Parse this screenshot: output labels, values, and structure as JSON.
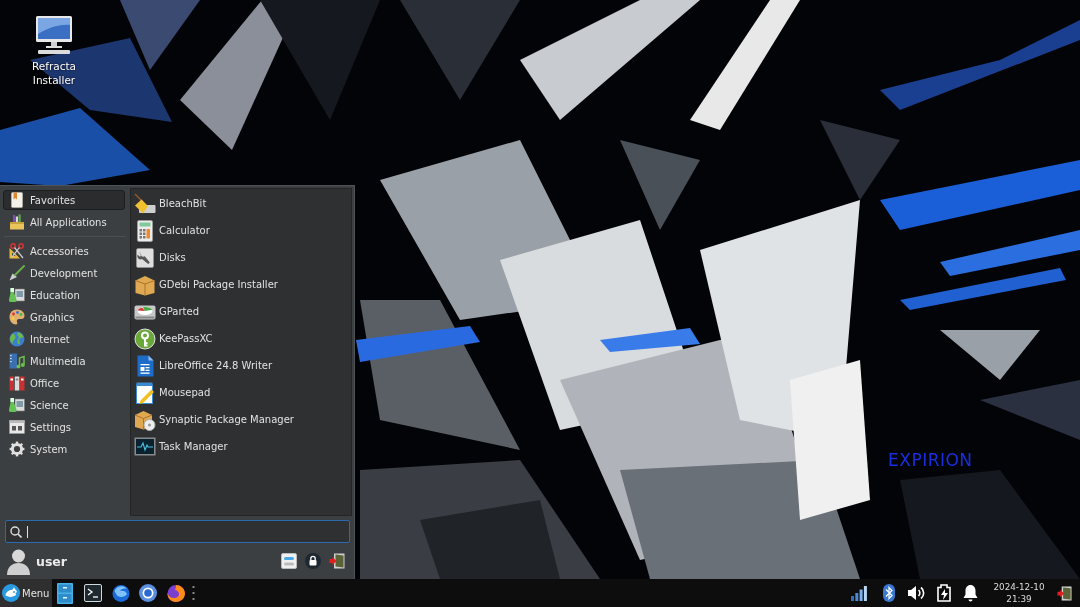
{
  "desktop": {
    "shortcuts": [
      {
        "label": "Refracta Installer"
      }
    ],
    "wallpaper_text": "EXPIRION"
  },
  "menu": {
    "views": [
      {
        "label": "Favorites",
        "selected": true
      },
      {
        "label": "All Applications",
        "selected": false
      }
    ],
    "categories": [
      {
        "label": "Accessories",
        "selected": false
      },
      {
        "label": "Development",
        "selected": false
      },
      {
        "label": "Education",
        "selected": false
      },
      {
        "label": "Graphics",
        "selected": false
      },
      {
        "label": "Internet",
        "selected": false
      },
      {
        "label": "Multimedia",
        "selected": false
      },
      {
        "label": "Office",
        "selected": false
      },
      {
        "label": "Science",
        "selected": false
      },
      {
        "label": "Settings",
        "selected": false
      },
      {
        "label": "System",
        "selected": false
      }
    ],
    "apps": [
      {
        "label": "BleachBit"
      },
      {
        "label": "Calculator"
      },
      {
        "label": "Disks"
      },
      {
        "label": "GDebi Package Installer"
      },
      {
        "label": "GParted"
      },
      {
        "label": "KeePassXC"
      },
      {
        "label": "LibreOffice 24.8 Writer"
      },
      {
        "label": "Mousepad"
      },
      {
        "label": "Synaptic Package Manager"
      },
      {
        "label": "Task Manager"
      }
    ],
    "user": {
      "name": "user"
    }
  },
  "taskbar": {
    "menu_button": {
      "label": "Menu",
      "pressed": true
    },
    "clock": {
      "date": "2024-12-10",
      "time": "21:39"
    }
  }
}
